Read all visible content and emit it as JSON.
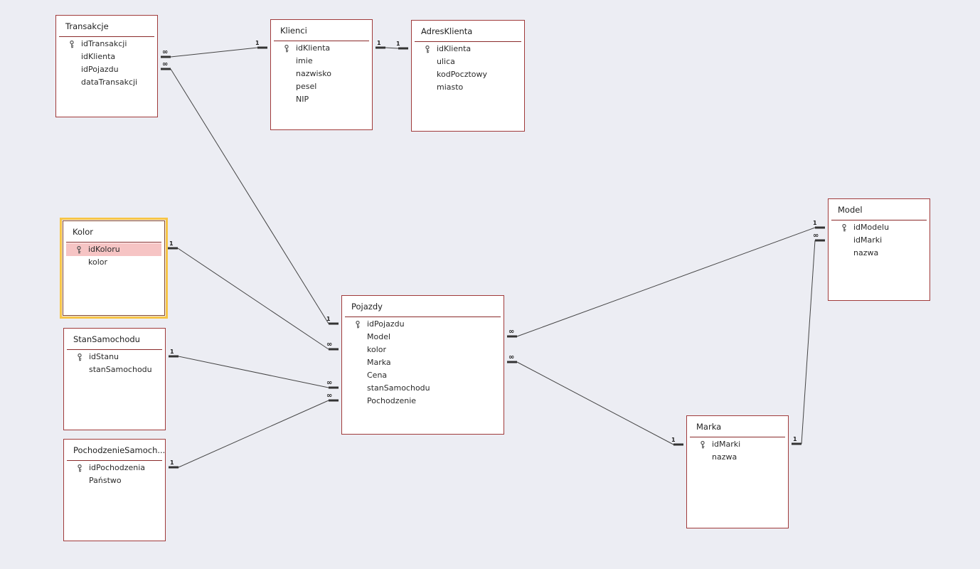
{
  "tables": [
    {
      "id": "transakcje",
      "name": "Transakcje",
      "selected": false,
      "fields": [
        {
          "name": "idTransakcji",
          "key": true
        },
        {
          "name": "idKlienta",
          "key": false
        },
        {
          "name": "idPojazdu",
          "key": false
        },
        {
          "name": "dataTransakcji",
          "key": false
        }
      ]
    },
    {
      "id": "klienci",
      "name": "Klienci",
      "selected": false,
      "fields": [
        {
          "name": "idKlienta",
          "key": true
        },
        {
          "name": "imie",
          "key": false
        },
        {
          "name": "nazwisko",
          "key": false
        },
        {
          "name": "pesel",
          "key": false
        },
        {
          "name": "NIP",
          "key": false
        }
      ]
    },
    {
      "id": "adresklienta",
      "name": "AdresKlienta",
      "selected": false,
      "fields": [
        {
          "name": "idKlienta",
          "key": true
        },
        {
          "name": "ulica",
          "key": false
        },
        {
          "name": "kodPocztowy",
          "key": false
        },
        {
          "name": "miasto",
          "key": false
        }
      ]
    },
    {
      "id": "kolor",
      "name": "Kolor",
      "selected": true,
      "fields": [
        {
          "name": "idKoloru",
          "key": true,
          "highlight": true
        },
        {
          "name": "kolor",
          "key": false
        }
      ]
    },
    {
      "id": "stansamochodu",
      "name": "StanSamochodu",
      "selected": false,
      "fields": [
        {
          "name": "idStanu",
          "key": true
        },
        {
          "name": "stanSamochodu",
          "key": false
        }
      ]
    },
    {
      "id": "pochodzeniesamochodu",
      "name": "PochodzenieSamoch...",
      "selected": false,
      "fields": [
        {
          "name": "idPochodzenia",
          "key": true
        },
        {
          "name": "Państwo",
          "key": false
        }
      ]
    },
    {
      "id": "pojazdy",
      "name": "Pojazdy",
      "selected": false,
      "fields": [
        {
          "name": "idPojazdu",
          "key": true
        },
        {
          "name": "Model",
          "key": false
        },
        {
          "name": "kolor",
          "key": false
        },
        {
          "name": "Marka",
          "key": false
        },
        {
          "name": "Cena",
          "key": false
        },
        {
          "name": "stanSamochodu",
          "key": false
        },
        {
          "name": "Pochodzenie",
          "key": false
        }
      ]
    },
    {
      "id": "model",
      "name": "Model",
      "selected": false,
      "fields": [
        {
          "name": "idModelu",
          "key": true
        },
        {
          "name": "idMarki",
          "key": false
        },
        {
          "name": "nazwa",
          "key": false
        }
      ]
    },
    {
      "id": "marka",
      "name": "Marka",
      "selected": false,
      "fields": [
        {
          "name": "idMarki",
          "key": true
        },
        {
          "name": "nazwa",
          "key": false
        }
      ]
    }
  ],
  "relationships": [
    {
      "from": "transakcje",
      "to": "klienci",
      "from_card": "∞",
      "to_card": "1"
    },
    {
      "from": "klienci",
      "to": "adresklienta",
      "from_card": "1",
      "to_card": "1"
    },
    {
      "from": "transakcje",
      "to": "pojazdy",
      "from_card": "∞",
      "to_card": "1"
    },
    {
      "from": "kolor",
      "to": "pojazdy",
      "from_card": "1",
      "to_card": "∞"
    },
    {
      "from": "stansamochodu",
      "to": "pojazdy",
      "from_card": "1",
      "to_card": "∞"
    },
    {
      "from": "pochodzeniesamochodu",
      "to": "pojazdy",
      "from_card": "1",
      "to_card": "∞"
    },
    {
      "from": "pojazdy",
      "to": "model",
      "from_card": "∞",
      "to_card": "1"
    },
    {
      "from": "pojazdy",
      "to": "marka",
      "from_card": "∞",
      "to_card": "1"
    },
    {
      "from": "marka",
      "to": "model",
      "from_card": "1",
      "to_card": "∞"
    }
  ],
  "colors": {
    "background": "#ecedf3",
    "table_border": "#a03a3a",
    "selection": "#f7c547",
    "highlight_row": "#f6c4c4",
    "line": "#444444"
  },
  "icons": {
    "primary_key": "key-icon"
  }
}
